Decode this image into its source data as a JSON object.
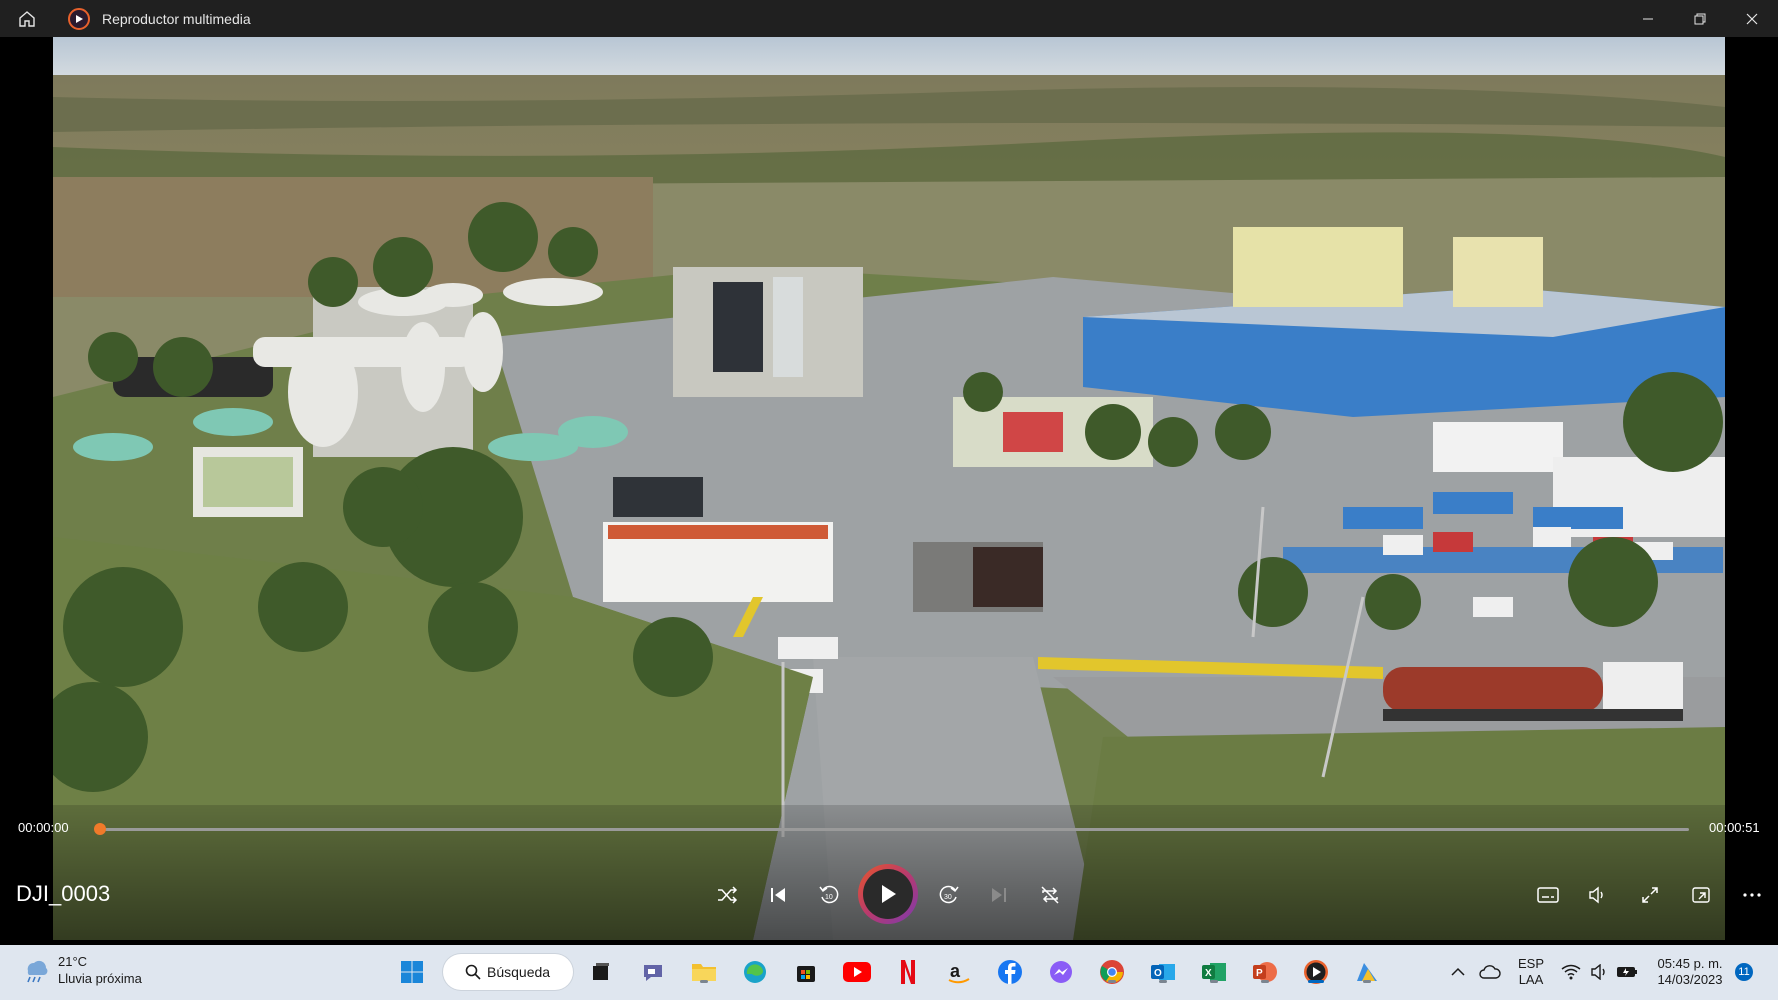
{
  "window": {
    "title": "Reproductor multimedia"
  },
  "player": {
    "current_time": "00:00:00",
    "total_time": "00:00:51",
    "progress": 0,
    "media_title": "DJI_0003"
  },
  "taskbar": {
    "weather_temp": "21°C",
    "weather_desc": "Lluvia próxima",
    "search_label": "Búsqueda",
    "language_line1": "ESP",
    "language_line2": "LAA",
    "clock_time": "05:45 p. m.",
    "clock_date": "14/03/2023",
    "notifications_count": "11"
  },
  "colors": {
    "accent": "#0067c0",
    "seek_thumb": "#f07a2a",
    "titlebar": "#202020",
    "taskbar": "#dfe6ef"
  }
}
